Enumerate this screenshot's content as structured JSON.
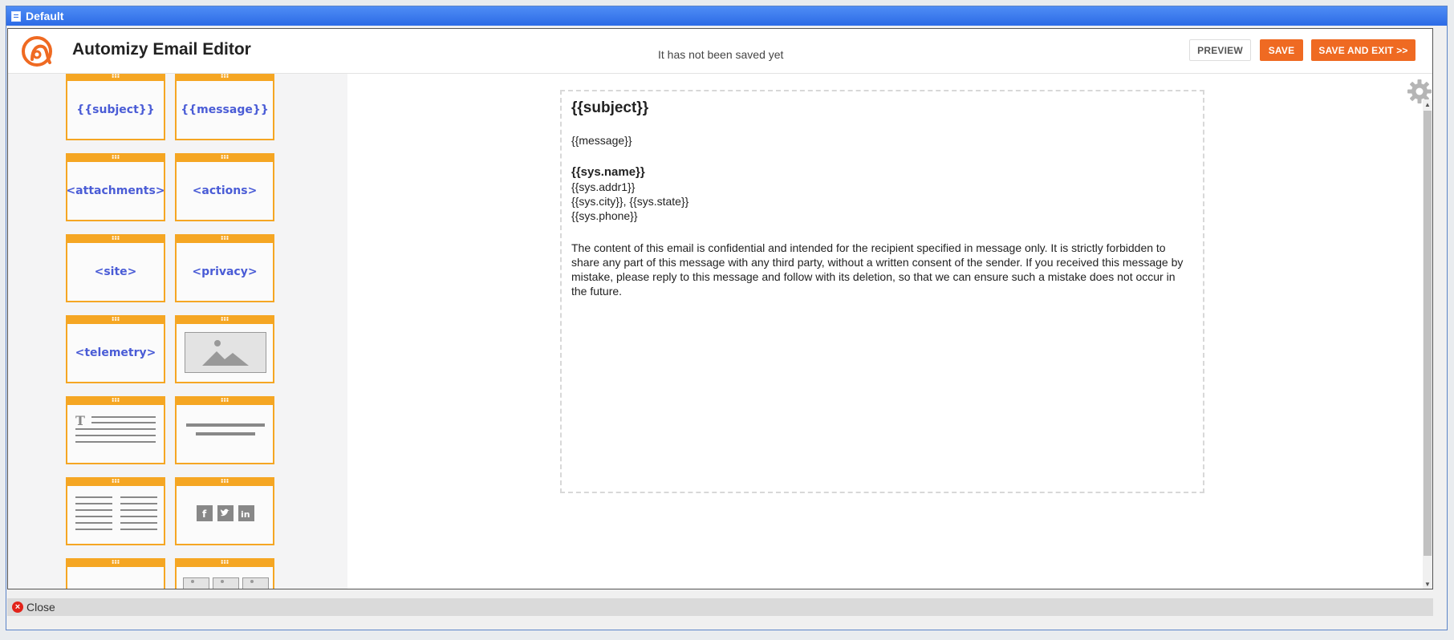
{
  "window": {
    "title": "Default"
  },
  "header": {
    "app_title": "Automizy Email Editor",
    "save_status": "It has not been saved yet",
    "preview_label": "PREVIEW",
    "save_label": "SAVE",
    "save_exit_label": "SAVE AND EXIT >>"
  },
  "colors": {
    "accent": "#ef6a22",
    "block_border": "#f5a623",
    "block_text": "#4a5cd6"
  },
  "sidebar": {
    "blocks": [
      {
        "label": "{{subject}}"
      },
      {
        "label": "{{message}}"
      },
      {
        "label": "<attachments>"
      },
      {
        "label": "<actions>"
      },
      {
        "label": "<site>"
      },
      {
        "label": "<privacy>"
      },
      {
        "label": "<telemetry>"
      },
      {
        "icon": "image-placeholder-icon"
      },
      {
        "icon": "text-block-icon"
      },
      {
        "icon": "divider-block-icon"
      },
      {
        "icon": "two-column-text-icon"
      },
      {
        "icon": "social-icons-block-icon"
      },
      {
        "icon": "empty-block-icon"
      },
      {
        "icon": "image-gallery-block-icon"
      }
    ]
  },
  "email": {
    "subject": "{{subject}}",
    "message": "{{message}}",
    "sys_name": "{{sys.name}}",
    "sys_addr": "{{sys.addr1}}",
    "sys_city_state": "{{sys.city}}, {{sys.state}}",
    "sys_phone": "{{sys.phone}}",
    "disclaimer": "The content of this email is confidential and intended for the recipient specified in message only. It is strictly forbidden to share any part of this message with any third party, without a written consent of the sender. If you received this message by mistake, please reply to this message and follow with its deletion, so that we can ensure such a mistake does not occur in the future."
  },
  "footer": {
    "close_label": "Close"
  }
}
